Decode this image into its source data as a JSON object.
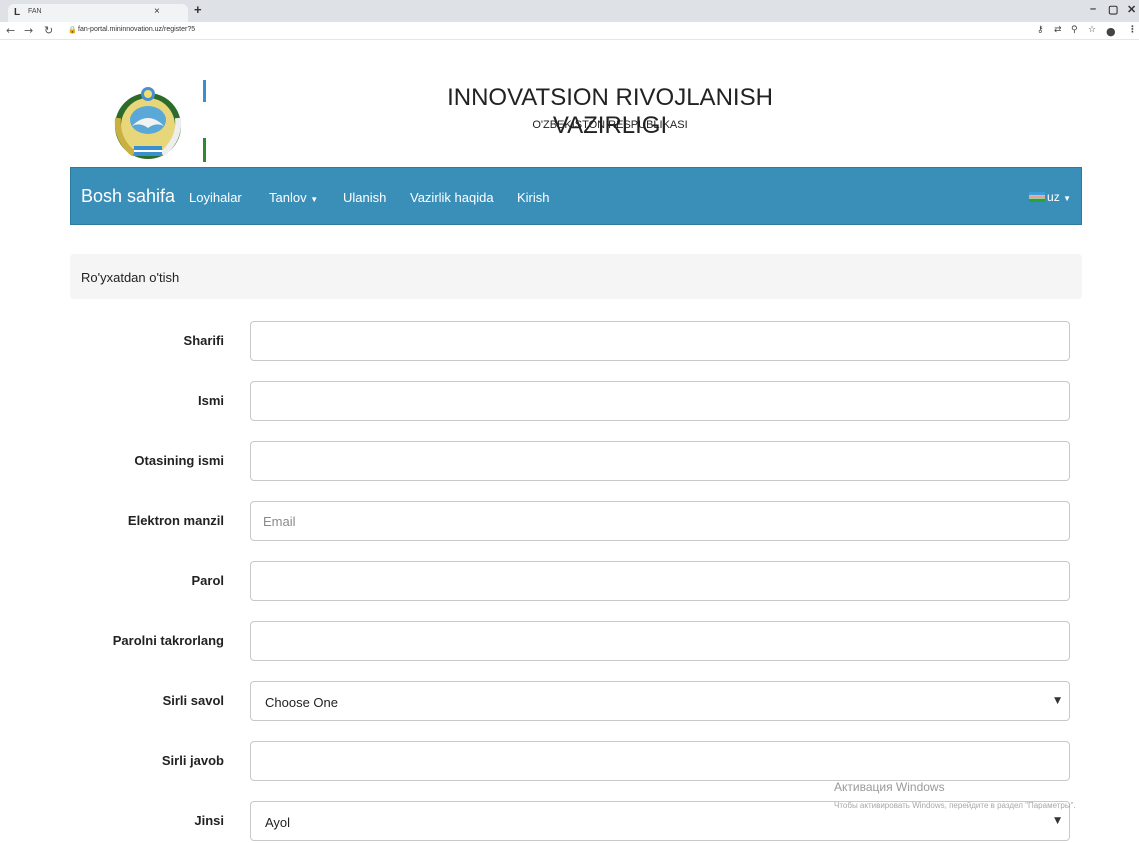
{
  "browser": {
    "tab_title": "FAN",
    "tab_close": "×",
    "new_tab": "+",
    "url": "fan-portal.mininnovation.uz/register?5",
    "window_controls": [
      "–",
      "▢",
      "✕"
    ]
  },
  "header": {
    "title": "INNOVATSION RIVOJLANISH VAZIRLIGI",
    "subtitle": "O'ZBEKISTON RESPUBLIKASI"
  },
  "navbar": {
    "brand": "Bosh sahifa",
    "items": [
      {
        "label": "Loyihalar"
      },
      {
        "label": "Tanlov",
        "dropdown": true
      },
      {
        "label": "Ulanish"
      },
      {
        "label": "Vazirlik haqida"
      },
      {
        "label": "Kirish"
      }
    ],
    "language": "uz",
    "colors": {
      "background": "#3a8fb8",
      "text": "#ffffff"
    }
  },
  "breadcrumb": "Ro'yxatdan o'tish",
  "form": {
    "fields": [
      {
        "label": "Sharifi",
        "type": "text",
        "value": "",
        "placeholder": ""
      },
      {
        "label": "Ismi",
        "type": "text",
        "value": "",
        "placeholder": ""
      },
      {
        "label": "Otasining ismi",
        "type": "text",
        "value": "",
        "placeholder": ""
      },
      {
        "label": "Elektron manzil",
        "type": "email",
        "value": "",
        "placeholder": "Email"
      },
      {
        "label": "Parol",
        "type": "password",
        "value": "",
        "placeholder": ""
      },
      {
        "label": "Parolni takrorlang",
        "type": "password",
        "value": "",
        "placeholder": ""
      },
      {
        "label": "Sirli savol",
        "type": "select",
        "value": "Choose One"
      },
      {
        "label": "Sirli javob",
        "type": "text",
        "value": "",
        "placeholder": ""
      },
      {
        "label": "Jinsi",
        "type": "select",
        "value": "Ayol"
      }
    ]
  },
  "watermark": {
    "line1": "Активация Windows",
    "line2": "Чтобы активировать Windows, перейдите в раздел \"Параметры\"."
  }
}
